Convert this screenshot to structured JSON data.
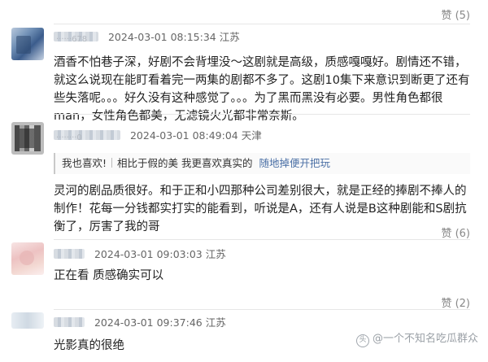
{
  "comments": [
    {
      "like_label": "赞 (5)"
    },
    {
      "username": "······678",
      "timestamp": "2024-03-01 08:15:34",
      "location": "江苏",
      "text": "酒香不怕巷子深，好剧不会背埋没～这剧就是高级，质感嘎嘎好。剧情还不错，就这么说现在能盯看着完一两集的剧都不多了。这剧10集下来意识到断更了还有些失落呢。。。好久没有这种感觉了。。。为了黑而黑没有必要。男性角色都很man，女性角色都美，无滤镜火光都非常奈斯。"
    },
    {
      "username": "········0",
      "timestamp": "2024-03-01 08:49:04",
      "location": "天津",
      "quote_user": "我也喜欢!",
      "quote_text": "相比于假的美 我更喜欢真实的",
      "quote_link": "随地掉便开把玩",
      "text": "灵河的剧品质很好。和于正和小四那种公司差别很大，就是正经的捧剧不捧人的制作！花每一分钱都实打实的能看到，听说是A，还有人说是B这种剧能和S剧抗衡了，厉害了我的哥",
      "like_label": "赞 (6)"
    },
    {
      "timestamp": "2024-03-01 09:03:03",
      "location": "江苏",
      "text": "正在看 质感确实可以",
      "like_label": "赞 (2)"
    },
    {
      "timestamp": "2024-03-01 09:37:46",
      "location": "江苏",
      "text": "光影真的很绝"
    }
  ],
  "watermark": {
    "logo": "头",
    "text": "@一个不知名吃瓜群众"
  }
}
